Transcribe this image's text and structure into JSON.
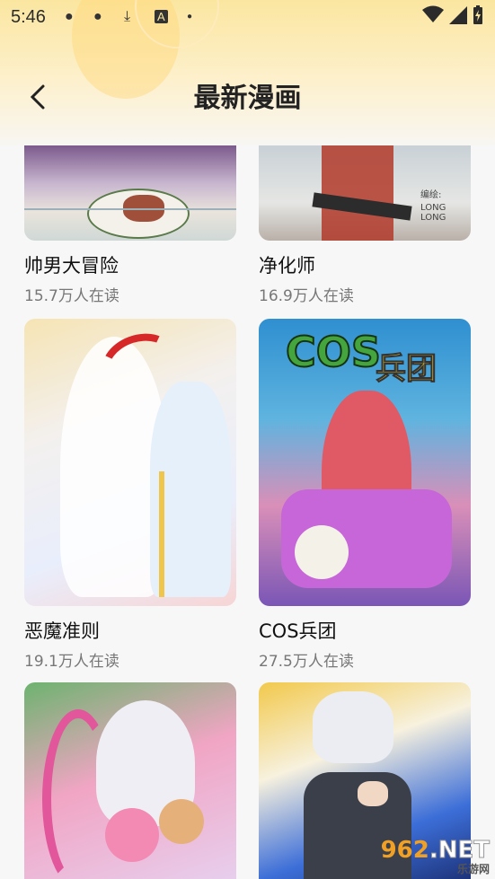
{
  "status_bar": {
    "time": "5:46",
    "icons": [
      "dot-icon",
      "dot-icon",
      "download-icon",
      "text-a-icon",
      "small-dot-icon",
      "wifi-icon",
      "signal-icon",
      "battery-charging-icon"
    ]
  },
  "header": {
    "title": "最新漫画",
    "back_icon": "chevron-left-icon"
  },
  "comics": [
    {
      "title": "帅男大冒险",
      "readers": "15.7万人在读"
    },
    {
      "title": "净化师",
      "readers": "16.9万人在读"
    },
    {
      "title": "恶魔准则",
      "readers": "19.1万人在读"
    },
    {
      "title": "COS兵团",
      "readers": "27.5万人在读"
    },
    {
      "title": "",
      "readers": ""
    },
    {
      "title": "",
      "readers": ""
    }
  ],
  "covers": {
    "jinghua_credit": "编绘:",
    "jinghua_author": "LONG LONG",
    "cos_logo_latin": "COS",
    "cos_logo_cn": "兵团"
  },
  "watermark": {
    "brand": "962",
    "suffix": ".NET",
    "sub": "乐游网"
  },
  "colors": {
    "header_gradient_top": "#fbe6a0",
    "background": "#f7f7f8",
    "title_text": "#222222",
    "subtitle_text": "#777777",
    "watermark_orange": "#f0a024"
  }
}
